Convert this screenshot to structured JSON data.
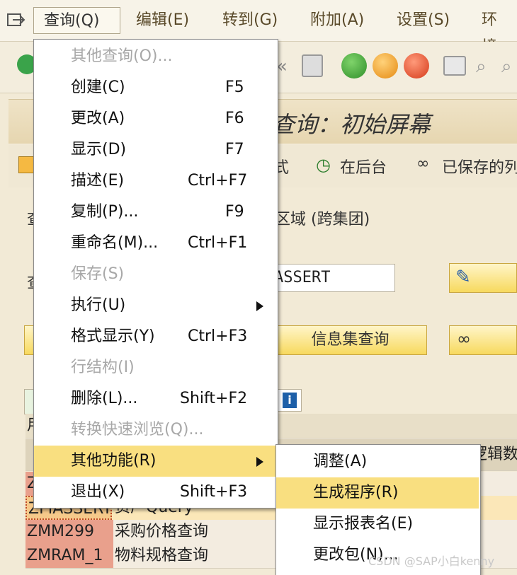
{
  "menubar": {
    "items": [
      "查询(Q)",
      "编辑(E)",
      "转到(G)",
      "附加(A)",
      "设置(S)",
      "环境"
    ]
  },
  "title": "查询：初始屏幕",
  "app_toolbar": {
    "item1": "式",
    "background": "在后台",
    "saved": "已保存的列"
  },
  "form": {
    "row1_label": "查",
    "row1_text": "区域 (跨集团)",
    "row2_label": "查",
    "query_value": "ASSERT",
    "infoset_button": "信息集查询"
  },
  "table": {
    "header_partial": "用",
    "col2_partial": "逻辑数",
    "rows": [
      {
        "name": "Z",
        "desc": ""
      },
      {
        "name": "ZFIASSERT",
        "desc": "资产Query"
      },
      {
        "name": "ZMM299",
        "desc": "采购价格查询"
      },
      {
        "name": "ZMRAM_1",
        "desc": "物料规格查询"
      }
    ]
  },
  "query_menu": {
    "items": [
      {
        "label": "其他查询(O)...",
        "shortcut": "",
        "disabled": true
      },
      {
        "label": "创建(C)",
        "shortcut": "F5",
        "disabled": false
      },
      {
        "label": "更改(A)",
        "shortcut": "F6",
        "disabled": false
      },
      {
        "label": "显示(D)",
        "shortcut": "F7",
        "disabled": false
      },
      {
        "label": "描述(E)",
        "shortcut": "Ctrl+F7",
        "disabled": false
      },
      {
        "label": "复制(P)...",
        "shortcut": "F9",
        "disabled": false
      },
      {
        "label": "重命名(M)...",
        "shortcut": "Ctrl+F1",
        "disabled": false
      },
      {
        "label": "保存(S)",
        "shortcut": "",
        "disabled": true
      },
      {
        "label": "执行(U)",
        "shortcut": "",
        "disabled": false,
        "submenu": true
      },
      {
        "label": "格式显示(Y)",
        "shortcut": "Ctrl+F3",
        "disabled": false
      },
      {
        "label": "行结构(I)",
        "shortcut": "",
        "disabled": true
      },
      {
        "label": "删除(L)...",
        "shortcut": "Shift+F2",
        "disabled": false
      },
      {
        "label": "转换快速浏览(Q)...",
        "shortcut": "",
        "disabled": true
      },
      {
        "label": "其他功能(R)",
        "shortcut": "",
        "disabled": false,
        "submenu": true,
        "highlighted": true
      },
      {
        "label": "退出(X)",
        "shortcut": "Shift+F3",
        "disabled": false
      }
    ]
  },
  "submenu": {
    "items": [
      {
        "label": "调整(A)",
        "highlighted": false
      },
      {
        "label": "生成程序(R)",
        "highlighted": true
      },
      {
        "label": "显示报表名(E)",
        "highlighted": false
      },
      {
        "label": "更改包(N)...",
        "highlighted": false
      }
    ]
  },
  "watermark": "CSDN @SAP小白kenny",
  "colors": {
    "menu_highlight": "#f9df80",
    "button_yellow": "#f7d95e",
    "row_name_bg": "#e9a08c"
  }
}
